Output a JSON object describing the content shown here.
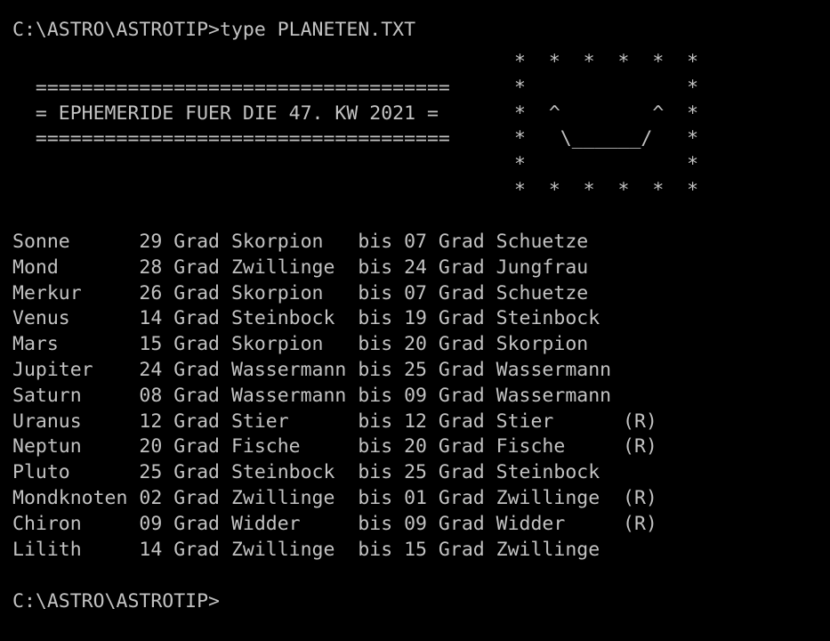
{
  "terminal": {
    "background_color": "#000000",
    "text_color": "#c2c2c2",
    "columns": 67,
    "rows": 24
  },
  "command_line": {
    "prompt": "C:\\ASTRO\\ASTROTIP>",
    "command": "type PLANETEN.TXT",
    "full": "C:\\ASTRO\\ASTROTIP>type PLANETEN.TXT"
  },
  "banner": {
    "rule_top": "  ====================================",
    "title": "  = EPHEMERIDE FUER DIE 47. KW 2021 =",
    "rule_bottom": "  ====================================",
    "ephemeride_label": "EPHEMERIDE FUER DIE",
    "calendar_week": "47.",
    "kw_label": "KW",
    "year": "2021"
  },
  "ascii_art": {
    "name": "smiley-face-star-border",
    "lines": [
      "*  *  *  *  *  *",
      "*              *",
      "*  ^        ^  *",
      "*   \\______/   *",
      "*              *",
      "*  *  *  *  *  *"
    ]
  },
  "table": {
    "header_present": false,
    "separator_word": "bis",
    "degree_word": "Grad",
    "retrograde_marker": "(R)",
    "rows": [
      {
        "body": "Sonne",
        "deg_from": "29",
        "unit_from": "Grad",
        "sign_from": "Skorpion",
        "bis": "bis",
        "deg_to": "07",
        "unit_to": "Grad",
        "sign_to": "Schuetze",
        "retro": ""
      },
      {
        "body": "Mond",
        "deg_from": "28",
        "unit_from": "Grad",
        "sign_from": "Zwillinge",
        "bis": "bis",
        "deg_to": "24",
        "unit_to": "Grad",
        "sign_to": "Jungfrau",
        "retro": ""
      },
      {
        "body": "Merkur",
        "deg_from": "26",
        "unit_from": "Grad",
        "sign_from": "Skorpion",
        "bis": "bis",
        "deg_to": "07",
        "unit_to": "Grad",
        "sign_to": "Schuetze",
        "retro": ""
      },
      {
        "body": "Venus",
        "deg_from": "14",
        "unit_from": "Grad",
        "sign_from": "Steinbock",
        "bis": "bis",
        "deg_to": "19",
        "unit_to": "Grad",
        "sign_to": "Steinbock",
        "retro": ""
      },
      {
        "body": "Mars",
        "deg_from": "15",
        "unit_from": "Grad",
        "sign_from": "Skorpion",
        "bis": "bis",
        "deg_to": "20",
        "unit_to": "Grad",
        "sign_to": "Skorpion",
        "retro": ""
      },
      {
        "body": "Jupiter",
        "deg_from": "24",
        "unit_from": "Grad",
        "sign_from": "Wassermann",
        "bis": "bis",
        "deg_to": "25",
        "unit_to": "Grad",
        "sign_to": "Wassermann",
        "retro": ""
      },
      {
        "body": "Saturn",
        "deg_from": "08",
        "unit_from": "Grad",
        "sign_from": "Wassermann",
        "bis": "bis",
        "deg_to": "09",
        "unit_to": "Grad",
        "sign_to": "Wassermann",
        "retro": ""
      },
      {
        "body": "Uranus",
        "deg_from": "12",
        "unit_from": "Grad",
        "sign_from": "Stier",
        "bis": "bis",
        "deg_to": "12",
        "unit_to": "Grad",
        "sign_to": "Stier",
        "retro": "(R)"
      },
      {
        "body": "Neptun",
        "deg_from": "20",
        "unit_from": "Grad",
        "sign_from": "Fische",
        "bis": "bis",
        "deg_to": "20",
        "unit_to": "Grad",
        "sign_to": "Fische",
        "retro": "(R)"
      },
      {
        "body": "Pluto",
        "deg_from": "25",
        "unit_from": "Grad",
        "sign_from": "Steinbock",
        "bis": "bis",
        "deg_to": "25",
        "unit_to": "Grad",
        "sign_to": "Steinbock",
        "retro": ""
      },
      {
        "body": "Mondknoten",
        "deg_from": "02",
        "unit_from": "Grad",
        "sign_from": "Zwillinge",
        "bis": "bis",
        "deg_to": "01",
        "unit_to": "Grad",
        "sign_to": "Zwillinge",
        "retro": "(R)"
      },
      {
        "body": "Chiron",
        "deg_from": "09",
        "unit_from": "Grad",
        "sign_from": "Widder",
        "bis": "bis",
        "deg_to": "09",
        "unit_to": "Grad",
        "sign_to": "Widder",
        "retro": "(R)"
      },
      {
        "body": "Lilith",
        "deg_from": "14",
        "unit_from": "Grad",
        "sign_from": "Zwillinge",
        "bis": "bis",
        "deg_to": "15",
        "unit_to": "Grad",
        "sign_to": "Zwillinge",
        "retro": ""
      }
    ]
  },
  "trailing_prompt": {
    "prompt": "C:\\ASTRO\\ASTROTIP>"
  }
}
